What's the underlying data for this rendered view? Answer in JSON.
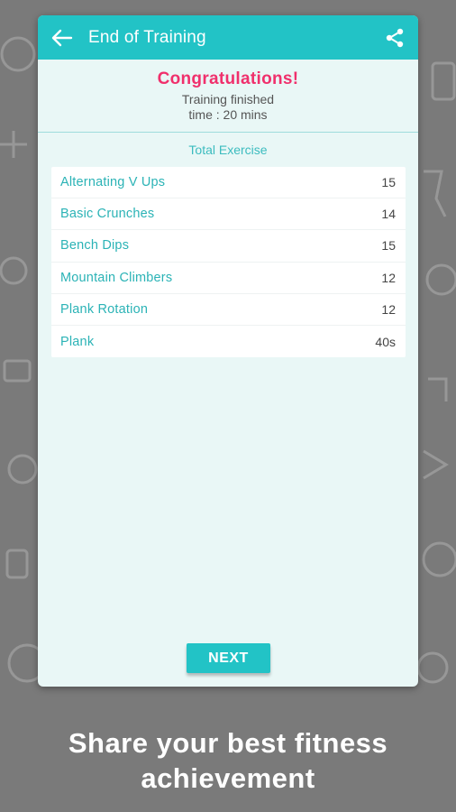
{
  "appbar": {
    "title": "End of Training",
    "back_icon": "arrow-left-icon",
    "share_icon": "share-icon"
  },
  "summary": {
    "congrats": "Congratulations!",
    "line1": "Training finished",
    "line2": "time : 20 mins"
  },
  "section_title": "Total Exercise",
  "exercises": [
    {
      "name": "Alternating V Ups",
      "value": "15"
    },
    {
      "name": "Basic Crunches",
      "value": "14"
    },
    {
      "name": "Bench Dips",
      "value": "15"
    },
    {
      "name": "Mountain Climbers",
      "value": "12"
    },
    {
      "name": "Plank Rotation",
      "value": "12"
    },
    {
      "name": "Plank",
      "value": "40s"
    }
  ],
  "next_label": "NEXT",
  "caption": {
    "line1": "Share your best fitness",
    "line2": "achievement"
  },
  "colors": {
    "accent": "#22c3c6",
    "congrats": "#f0306c",
    "background": "#7a7a7a",
    "card": "#e9f7f6"
  }
}
